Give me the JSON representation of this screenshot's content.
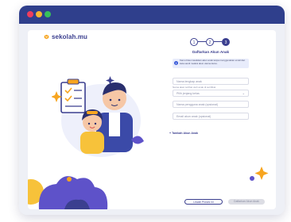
{
  "window": {
    "controls": [
      "close",
      "minimize",
      "maximize"
    ]
  },
  "brand": {
    "name": "sekolah.mu"
  },
  "stepper": {
    "steps": [
      "1",
      "2",
      "3"
    ],
    "active": 3
  },
  "form": {
    "title": "Daftarkan Akun Anak",
    "info": "Kamu bisa masukkan akun anak tanpa menggunakan email dan kata sandi melalui akun utama kamu.",
    "fields": {
      "name_placeholder": "Nama lengkap anak",
      "name_hint": "Nama akan terlihat oleh anak di sertifikat",
      "grade_placeholder": "Pilih jenjang kelas",
      "username_placeholder": "Nama pengguna anak (opsional)",
      "email_placeholder": "Email akun anak (opsional)"
    },
    "add_link": "+ Tambah Akun Anak",
    "buttons": {
      "skip": "Lewati Proses Ini",
      "submit": "Daftarkan Akun Anak"
    }
  },
  "colors": {
    "titlebar": "#2f3f8c",
    "brand": "#3b3f8f",
    "info_bg": "#e8ecfb",
    "accent_orange": "#f7a520",
    "accent_purple": "#5e52c9"
  }
}
